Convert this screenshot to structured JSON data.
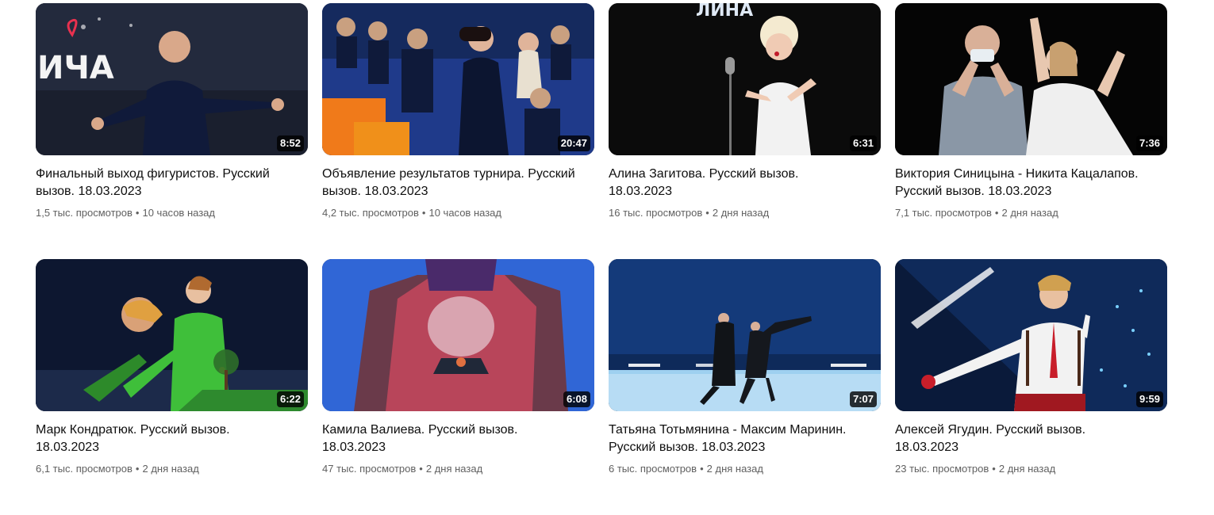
{
  "videos": [
    {
      "title": "Финальный выход фигуристов. Русский вызов. 18.03.2023",
      "duration": "8:52",
      "views": "1,5 тыс. просмотров",
      "age": "10 часов назад",
      "bg": "#1a1f2e",
      "accent": "#e8314f"
    },
    {
      "title": "Объявление результатов турнира. Русский вызов. 18.03.2023",
      "duration": "20:47",
      "views": "4,2 тыс. просмотров",
      "age": "10 часов назад",
      "bg": "#1f3a8a",
      "accent": "#f07a1a"
    },
    {
      "title": "Алина Загитова. Русский вызов. 18.03.2023",
      "duration": "6:31",
      "views": "16 тыс. просмотров",
      "age": "2 дня назад",
      "bg": "#0b0b0b",
      "accent": "#f2f2f2"
    },
    {
      "title": "Виктория Синицына - Никита Кацалапов. Русский вызов. 18.03.2023",
      "duration": "7:36",
      "views": "7,1 тыс. просмотров",
      "age": "2 дня назад",
      "bg": "#050505",
      "accent": "#8a97a6"
    },
    {
      "title": "Марк Кондратюк. Русский вызов. 18.03.2023",
      "duration": "6:22",
      "views": "6,1 тыс. просмотров",
      "age": "2 дня назад",
      "bg": "#0d1730",
      "accent": "#3fbf3a"
    },
    {
      "title": "Камила Валиева. Русский вызов. 18.03.2023",
      "duration": "6:08",
      "views": "47 тыс. просмотров",
      "age": "2 дня назад",
      "bg": "#2a5fcf",
      "accent": "#b8455a"
    },
    {
      "title": "Татьяна Тотьмянина - Максим Маринин. Русский вызов. 18.03.2023",
      "duration": "7:07",
      "views": "6 тыс. просмотров",
      "age": "2 дня назад",
      "bg": "#0e2a5a",
      "accent": "#9ed0f0"
    },
    {
      "title": "Алексей Ягудин. Русский вызов. 18.03.2023",
      "duration": "9:59",
      "views": "23 тыс. просмотров",
      "age": "2 дня назад",
      "bg": "#0a1a3a",
      "accent": "#c81e2a"
    }
  ],
  "separator": "•"
}
